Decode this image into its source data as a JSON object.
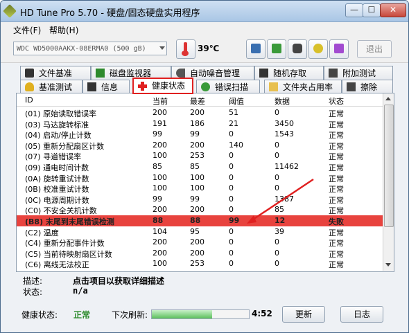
{
  "window": {
    "title": "HD Tune Pro 5.70 - 硬盘/固态硬盘实用程序",
    "controls": {
      "minimize": "—",
      "maximize": "☐",
      "close": "✕"
    }
  },
  "menu": {
    "file": "文件(F)",
    "help": "帮助(H)"
  },
  "toolbar": {
    "drive": "WDC WD5000AAKX-08ERMA0 (500 gB)",
    "temperature": "39℃",
    "exit_label": "退出",
    "icons": [
      "copy-info-icon",
      "copy-screen-icon",
      "camera-icon",
      "pipe-icon",
      "download-icon"
    ]
  },
  "tabs_row1": [
    {
      "label": "文件基准",
      "icon": "file-benchmark-icon"
    },
    {
      "label": "磁盘监视器",
      "icon": "disk-monitor-icon"
    },
    {
      "label": "自动噪音管理",
      "icon": "speaker-icon"
    },
    {
      "label": "随机存取",
      "icon": "random-access-icon"
    },
    {
      "label": "附加测试",
      "icon": "extra-tests-icon"
    }
  ],
  "tabs_row2": [
    {
      "label": "基准测试",
      "icon": "benchmark-icon"
    },
    {
      "label": "信息",
      "icon": "info-icon"
    },
    {
      "label": "健康状态",
      "icon": "health-cross-icon",
      "active": true
    },
    {
      "label": "错误扫描",
      "icon": "error-scan-icon"
    },
    {
      "label": "文件夹占用率",
      "icon": "folder-icon"
    },
    {
      "label": "擦除",
      "icon": "erase-icon"
    }
  ],
  "grid": {
    "headers": [
      "ID",
      "当前",
      "最差",
      "阈值",
      "数据",
      "状态"
    ],
    "rows": [
      [
        "(01) 原始读取错误率",
        "200",
        "200",
        "51",
        "0",
        "正常"
      ],
      [
        "(03) 马达旋转标准",
        "191",
        "186",
        "21",
        "3450",
        "正常"
      ],
      [
        "(04) 启动/停止计数",
        "99",
        "99",
        "0",
        "1543",
        "正常"
      ],
      [
        "(05) 重新分配扇区计数",
        "200",
        "200",
        "140",
        "0",
        "正常"
      ],
      [
        "(07) 寻道错误率",
        "100",
        "253",
        "0",
        "0",
        "正常"
      ],
      [
        "(09) 通电时间计数",
        "85",
        "85",
        "0",
        "11462",
        "正常"
      ],
      [
        "(0A) 旋转重试计数",
        "100",
        "100",
        "0",
        "0",
        "正常"
      ],
      [
        "(0B) 校准重试计数",
        "100",
        "100",
        "0",
        "0",
        "正常"
      ],
      [
        "(0C) 电源周期计数",
        "99",
        "99",
        "0",
        "1387",
        "正常"
      ],
      [
        "(C0) 不安全关机计数",
        "200",
        "200",
        "0",
        "85",
        "正常"
      ],
      [
        "(B8) 末尾到末尾错误检测",
        "88",
        "88",
        "99",
        "12",
        "失败"
      ],
      [
        "(C2) 温度",
        "104",
        "95",
        "0",
        "39",
        "正常"
      ],
      [
        "(C4) 重新分配事件计数",
        "200",
        "200",
        "0",
        "0",
        "正常"
      ],
      [
        "(C5) 当前待映射扇区计数",
        "200",
        "200",
        "0",
        "0",
        "正常"
      ],
      [
        "(C6) 离线无法校正",
        "100",
        "253",
        "0",
        "0",
        "正常"
      ]
    ],
    "alert_row_index": 10
  },
  "description": {
    "desc_label": "描述:",
    "desc_value": "点击项目以获取详细描述",
    "status_label": "状态:",
    "status_value": "n/a"
  },
  "footer": {
    "health_label": "健康状态:",
    "health_value": "正常",
    "refresh_label": "下次刷新:",
    "refresh_progress": 0.62,
    "refresh_time": "4:52",
    "refresh_button": "更新",
    "log_button": "日志"
  },
  "colors": {
    "alert_row": "#e8433e",
    "health_ok": "#2a8a2a",
    "active_tab_border": "#e02020"
  }
}
